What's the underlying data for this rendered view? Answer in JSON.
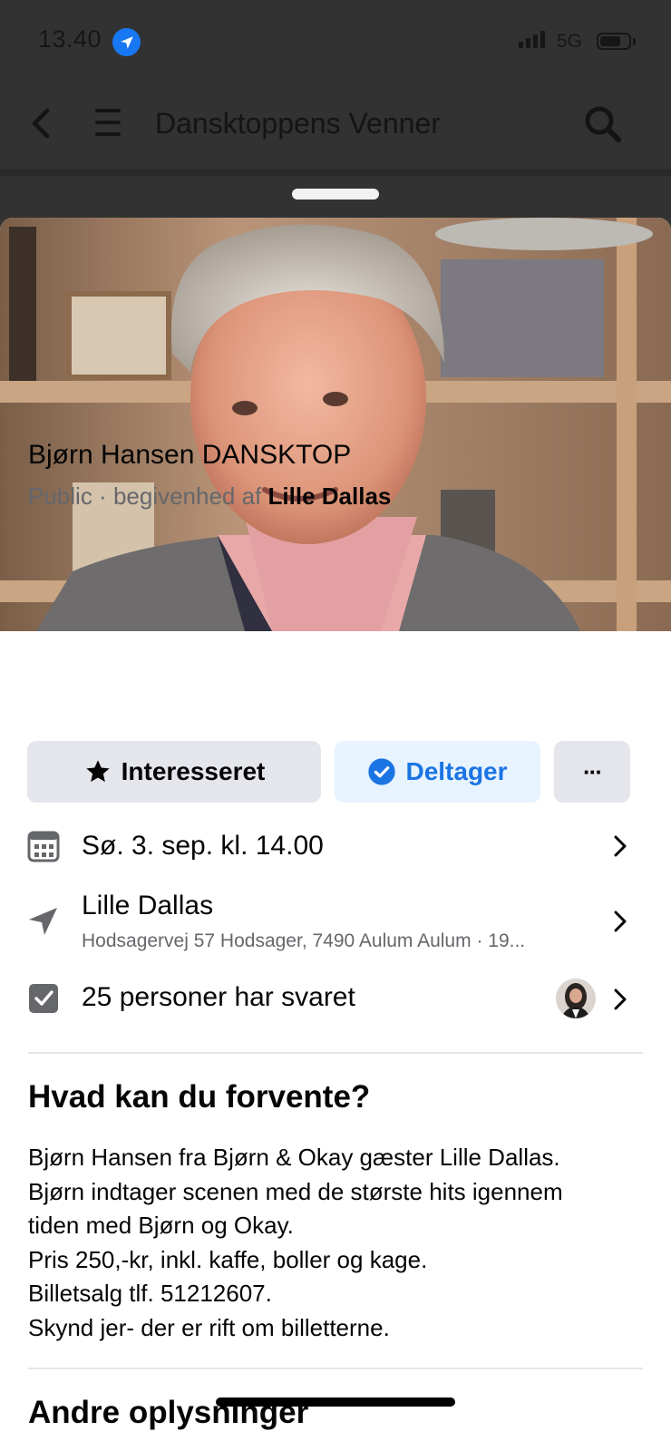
{
  "status_bar": {
    "time": "13.40",
    "network": "5G",
    "battery_level": 0.76
  },
  "nav": {
    "title": "Dansktoppens Venner"
  },
  "event": {
    "title": "Bjørn Hansen DANSKTOP",
    "privacy": "Public",
    "separator": " · ",
    "hosted_by_prefix": "begivenhed af ",
    "host": "Lille Dallas"
  },
  "actions": {
    "interested_label": "Interesseret",
    "going_label": "Deltager",
    "more_label": "···"
  },
  "details": {
    "date": "Sø. 3. sep. kl. 14.00",
    "location_name": "Lille Dallas",
    "location_address": "Hodsagervej 57 Hodsager, 7490 Aulum Aulum · 19...",
    "responses": "25 personer har svaret"
  },
  "about": {
    "heading": "Hvad kan du forvente?",
    "lines": [
      "Bjørn Hansen fra Bjørn & Okay gæster Lille Dallas.",
      "Bjørn indtager scenen med de største hits igennem",
      "tiden med Bjørn og Okay.",
      "Pris 250,-kr, inkl. kaffe, boller og kage.",
      "Billetsalg tlf. 51212607.",
      "Skynd jer- der er rift om billetterne."
    ]
  },
  "more_info": {
    "heading": "Andre oplysninger"
  },
  "icons": {
    "back": "back-arrow-icon",
    "menu": "menu-icon",
    "search": "search-icon",
    "location_services": "location-arrow-icon",
    "interested": "star-icon",
    "going": "check-circle-icon",
    "calendar": "calendar-icon",
    "location": "navigation-arrow-icon",
    "responses": "checkbox-icon",
    "chevron": "chevron-right-icon"
  },
  "colors": {
    "accent": "#1b74e4",
    "accent_bg": "#e7f3ff",
    "button_gray": "#e4e6eb",
    "header_bg": "#323232"
  }
}
